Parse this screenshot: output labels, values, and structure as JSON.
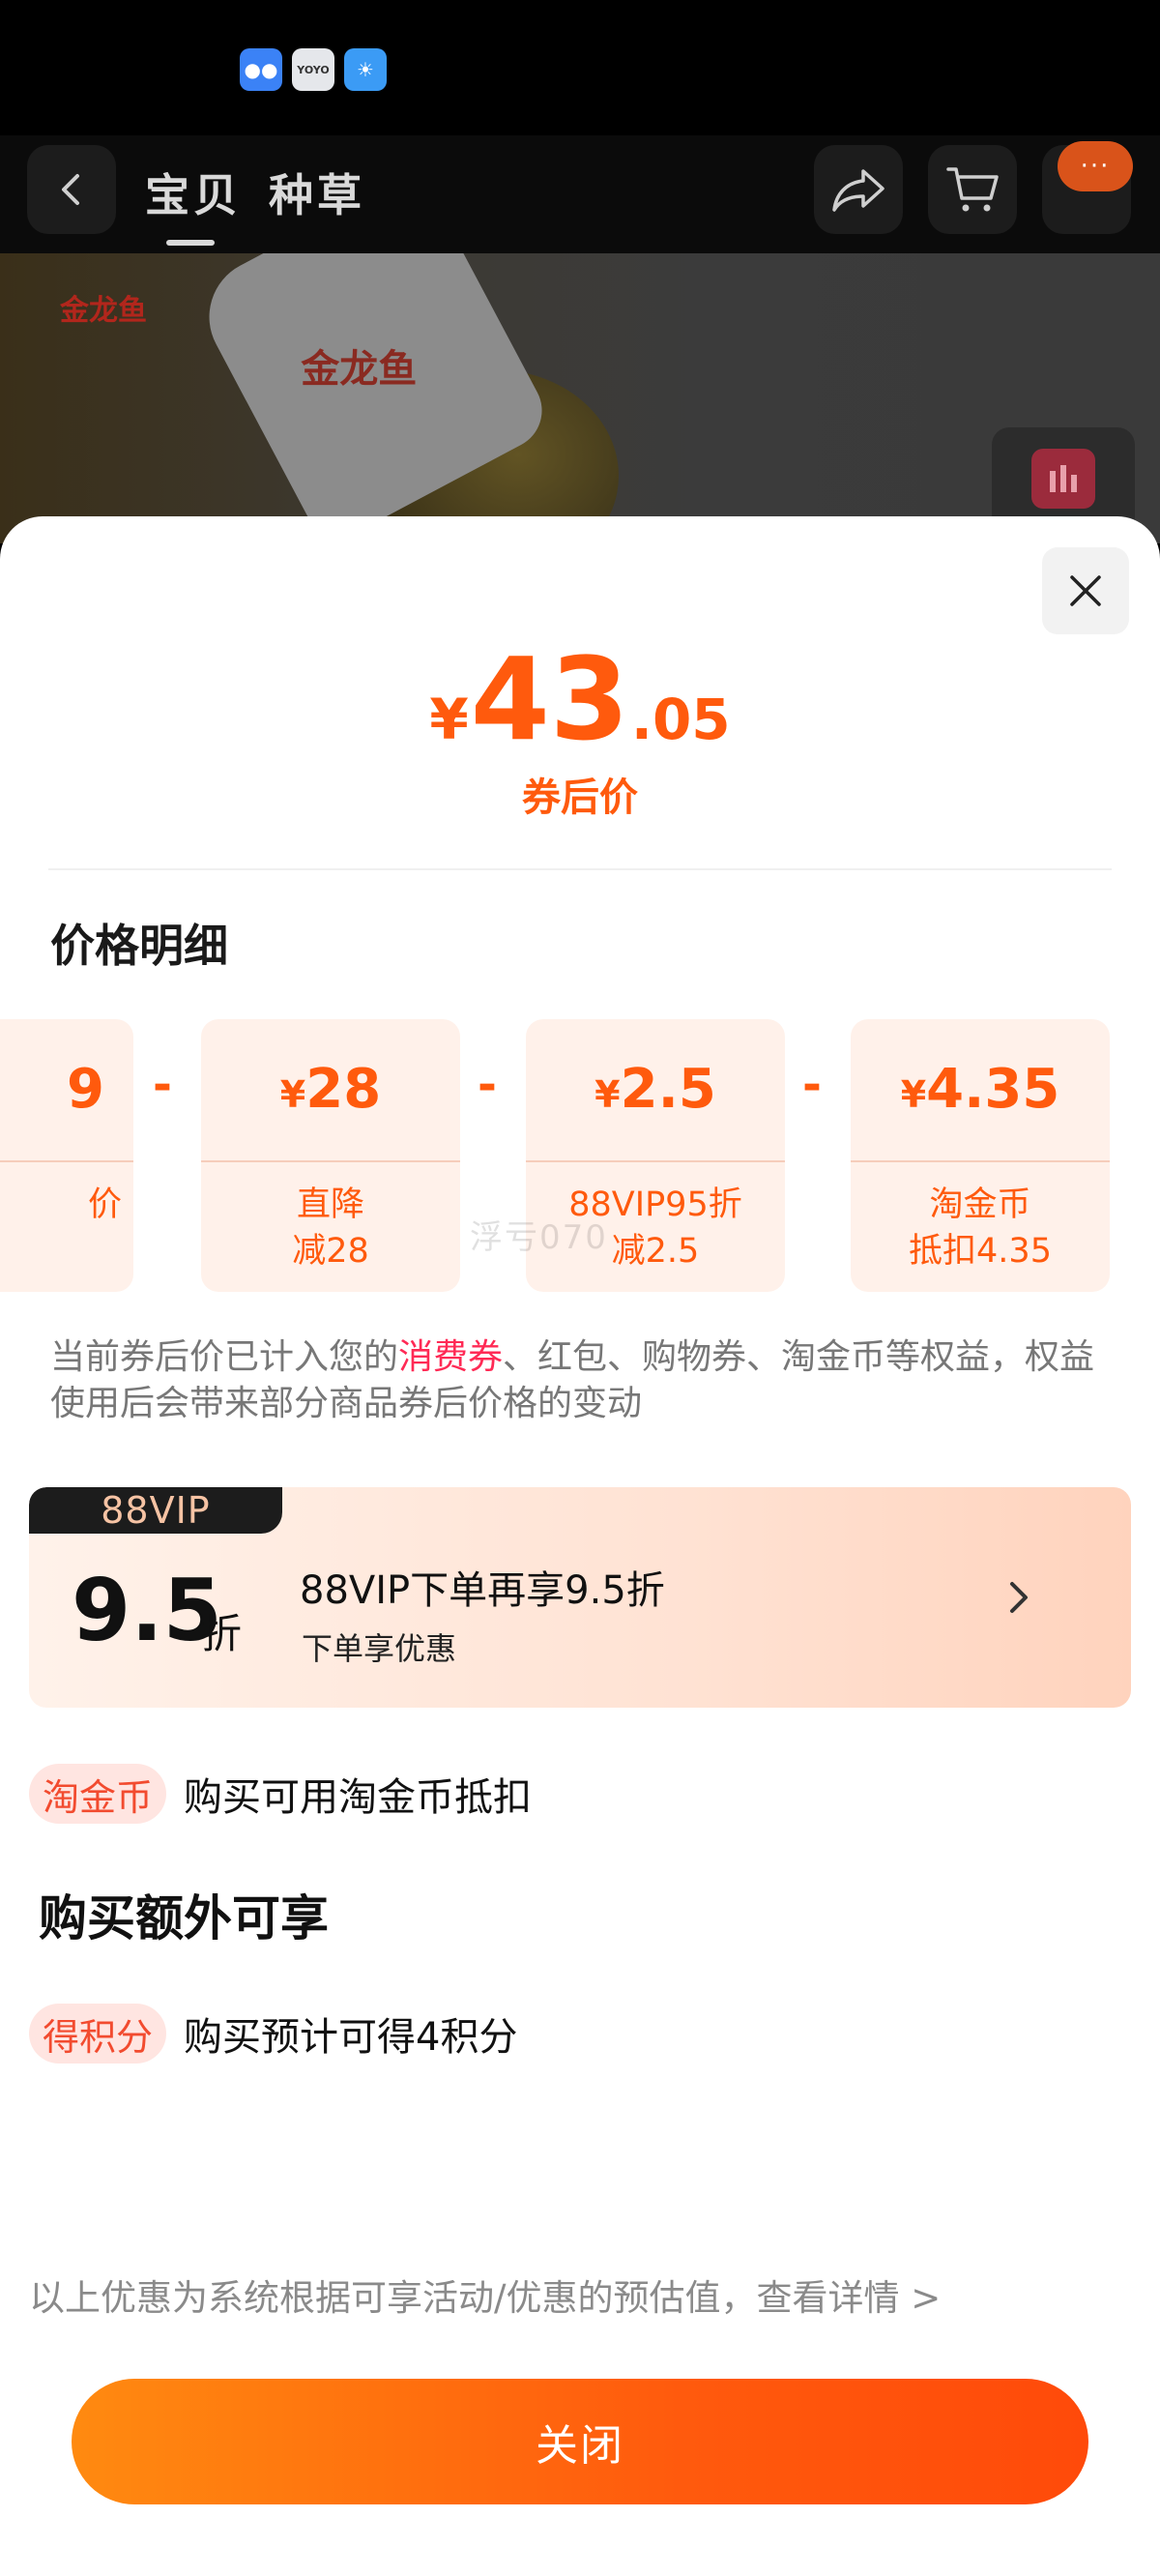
{
  "status_bar": {
    "icons": [
      "chat-bubble-icon",
      "yoyo-app-icon",
      "weather-icon"
    ],
    "yoyo_label": "YOYO"
  },
  "nav": {
    "tabs": [
      "宝贝",
      "种草"
    ],
    "more_badge": "···"
  },
  "product": {
    "brand": "金龙鱼",
    "cap_label": "金龙鱼"
  },
  "sheet": {
    "price": {
      "currency": "¥",
      "integer": "43",
      "decimal": ".05",
      "label": "券后价"
    },
    "detail_title": "价格明细",
    "cards": [
      {
        "amount": "9",
        "currency": "",
        "desc": [
          "价",
          ""
        ]
      },
      {
        "amount": "28",
        "currency": "¥",
        "desc": [
          "直降",
          "减28"
        ]
      },
      {
        "amount": "2.5",
        "currency": "¥",
        "desc": [
          "88VIP95折",
          "减2.5"
        ]
      },
      {
        "amount": "4.35",
        "currency": "¥",
        "desc": [
          "淘金币",
          "抵扣4.35"
        ]
      }
    ],
    "minus_sign": "-",
    "watermark": "浮亏070",
    "note": {
      "before": "当前券后价已计入您的",
      "highlight": "消费券",
      "after": "、红包、购物券、淘金币等权益，权益使用后会带来部分商品券后价格的变动"
    },
    "vip": {
      "tag": "88VIP",
      "discount": "9.5",
      "discount_unit": "折",
      "title": "88VIP下单再享9.5折",
      "subtitle": "下单享优惠"
    },
    "coin": {
      "pill": "淘金币",
      "text": "购买可用淘金币抵扣"
    },
    "extra_title": "购买额外可享",
    "points": {
      "pill": "得积分",
      "text": "购买预计可得4积分"
    },
    "footer_note": "以上优惠为系统根据可享活动/优惠的预估值，查看详情 >",
    "close_button": "关闭"
  },
  "colors": {
    "accent": "#ff5a0d",
    "accent_light": "#fff1ea",
    "highlight": "#ff2a55",
    "pill_bg": "#ffe5e1",
    "pill_text": "#f24b2f"
  }
}
